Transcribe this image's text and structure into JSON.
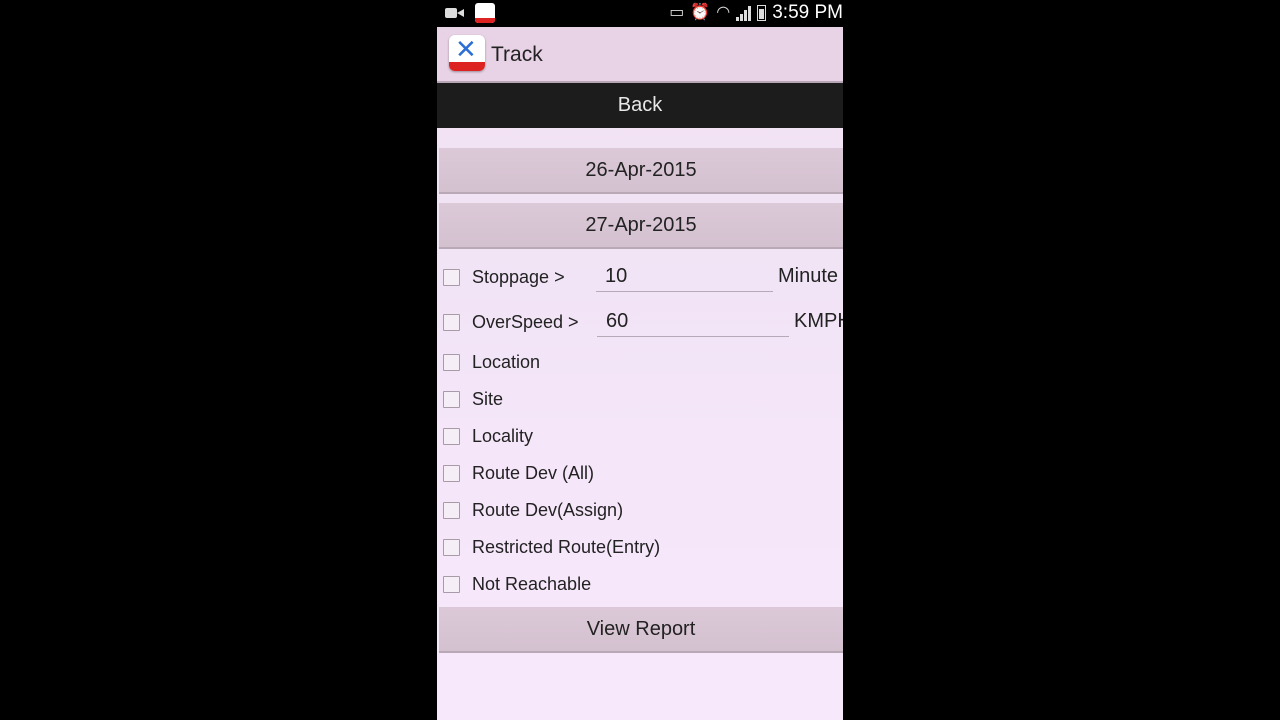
{
  "status_bar": {
    "time": "3:59 PM",
    "icons": [
      "video-camera-icon",
      "app-notification-icon",
      "cast-icon",
      "alarm-icon",
      "wifi-icon",
      "signal-icon",
      "battery-icon"
    ]
  },
  "action_bar": {
    "title": "Track",
    "logo_icon": "x-logo-icon"
  },
  "back_bar": {
    "label": "Back"
  },
  "dates": {
    "from": "26-Apr-2015",
    "to": "27-Apr-2015"
  },
  "filters": {
    "stoppage": {
      "label": "Stoppage >",
      "value": "10",
      "unit": "Minute"
    },
    "overspeed": {
      "label": "OverSpeed >",
      "value": "60",
      "unit": "KMPH"
    },
    "items": [
      {
        "label": "Location"
      },
      {
        "label": "Site"
      },
      {
        "label": "Locality"
      },
      {
        "label": "Route Dev (All)"
      },
      {
        "label": "Route Dev(Assign)"
      },
      {
        "label": "Restricted Route(Entry)"
      },
      {
        "label": "Not Reachable"
      }
    ]
  },
  "actions": {
    "view_report_label": "View Report"
  },
  "colors": {
    "action_bar_bg": "#e8d2e6",
    "back_bar_bg": "#1c1c1c",
    "button_bg": "#d8c5d4",
    "screen_bg": "#f3e2f6",
    "logo_accent": "#dd2222",
    "logo_blue": "#2a6fd1"
  }
}
